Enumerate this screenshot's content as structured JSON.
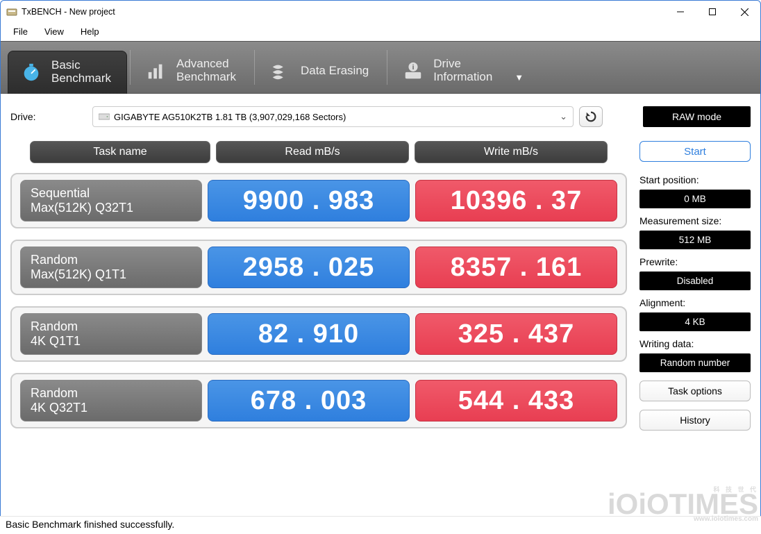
{
  "window": {
    "title": "TxBENCH - New project"
  },
  "menu": {
    "file": "File",
    "view": "View",
    "help": "Help"
  },
  "tabs": {
    "basic": {
      "line1": "Basic",
      "line2": "Benchmark"
    },
    "advanced": {
      "line1": "Advanced",
      "line2": "Benchmark"
    },
    "erase": {
      "line1": "Data Erasing",
      "line2": ""
    },
    "drive": {
      "line1": "Drive",
      "line2": "Information"
    }
  },
  "drive": {
    "label": "Drive:",
    "selected": "GIGABYTE AG510K2TB  1.81 TB (3,907,029,168 Sectors)"
  },
  "raw_mode": "RAW mode",
  "headers": {
    "task": "Task name",
    "read": "Read mB/s",
    "write": "Write mB/s"
  },
  "rows": [
    {
      "t1": "Sequential",
      "t2": "Max(512K) Q32T1",
      "read": "9900 . 983",
      "write": "10396 . 37"
    },
    {
      "t1": "Random",
      "t2": "Max(512K) Q1T1",
      "read": "2958 . 025",
      "write": "8357 . 161"
    },
    {
      "t1": "Random",
      "t2": "4K Q1T1",
      "read": "82 . 910",
      "write": "325 . 437"
    },
    {
      "t1": "Random",
      "t2": "4K Q32T1",
      "read": "678 . 003",
      "write": "544 . 433"
    }
  ],
  "side": {
    "start": "Start",
    "start_position_label": "Start position:",
    "start_position_value": "0 MB",
    "measurement_label": "Measurement size:",
    "measurement_value": "512 MB",
    "prewrite_label": "Prewrite:",
    "prewrite_value": "Disabled",
    "alignment_label": "Alignment:",
    "alignment_value": "4 KB",
    "writing_label": "Writing data:",
    "writing_value": "Random number",
    "task_options": "Task options",
    "history": "History"
  },
  "status": "Basic Benchmark finished successfully.",
  "watermark": {
    "small": "科 技 世 代",
    "main": "iOiOTIMES",
    "url": "www.ioiotimes.com"
  }
}
